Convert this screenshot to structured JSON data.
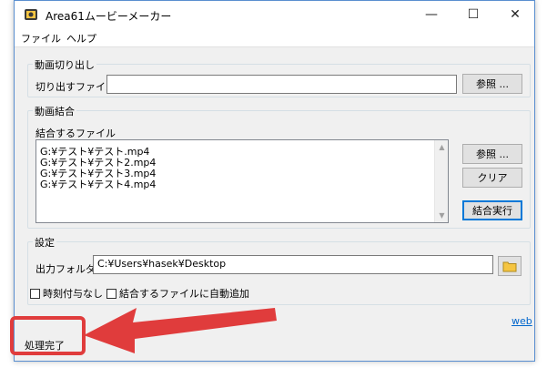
{
  "window": {
    "title": "Area61ムービーメーカー",
    "controls": {
      "minimize": "—",
      "maximize": "☐",
      "close": "✕"
    }
  },
  "menu": [
    "ファイル",
    "ヘルプ"
  ],
  "cut_section": {
    "title": "動画切り出し",
    "file_label": "切り出すファイル",
    "file_value": "",
    "browse_label": "参照 ..."
  },
  "merge_section": {
    "title": "動画結合",
    "list_label": "結合するファイル",
    "files": [
      "G:¥テスト¥テスト.mp4",
      "G:¥テスト¥テスト2.mp4",
      "G:¥テスト¥テスト3.mp4",
      "G:¥テスト¥テスト4.mp4"
    ],
    "browse_label": "参照 ...",
    "clear_label": "クリア",
    "execute_label": "結合実行"
  },
  "settings_section": {
    "title": "設定",
    "output_label": "出力フォルダ",
    "output_value": "C:¥Users¥hasek¥Desktop",
    "no_timestamp_label": "時刻付与なし",
    "auto_add_label": "結合するファイルに自動追加"
  },
  "web_link": "web",
  "status": "処理完了",
  "colors": {
    "highlight": "#e03c3c",
    "accent": "#0078d7",
    "folder": "#f5c542"
  }
}
